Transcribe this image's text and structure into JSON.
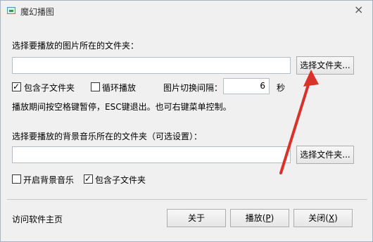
{
  "window": {
    "title": "魔幻播图",
    "close_glyph": "×"
  },
  "image_folder": {
    "label": "选择要播放的图片所在的文件夹：",
    "path_value": "",
    "browse_label": "选择文件夹..."
  },
  "options": {
    "include_subfolders_label": "包含子文件夹",
    "include_subfolders_checked": true,
    "loop_label": "循环播放",
    "loop_checked": false,
    "interval_label": "图片切换间隔：",
    "interval_value": "6",
    "interval_unit": "秒"
  },
  "hint": "播放期间按空格键暂停，ESC键退出。也可右键菜单控制。",
  "music_folder": {
    "label": "选择要播放的背景音乐所在的文件夹（可选设置）：",
    "path_value": "",
    "browse_label": "选择文件夹..."
  },
  "music_options": {
    "enable_music_label": "开启背景音乐",
    "enable_music_checked": false,
    "include_subfolders_label": "包含子文件夹",
    "include_subfolders_checked": true
  },
  "footer": {
    "homepage_link": "访问软件主页",
    "about_label": "关于",
    "play_label": "播放(",
    "play_key": "P",
    "play_suffix": ")",
    "close_label": "关闭(",
    "close_key": "X",
    "close_suffix": ")"
  },
  "annotation": {
    "arrow_color": "#d9322b"
  }
}
